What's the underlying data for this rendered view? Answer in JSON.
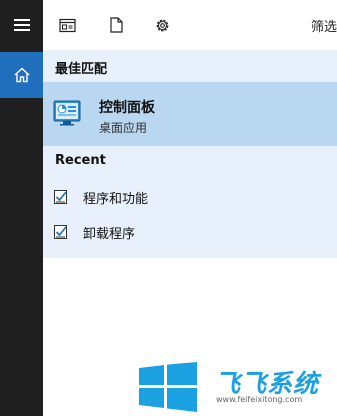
{
  "topbar": {
    "filter_label": "筛选",
    "icons": [
      "document-list-icon",
      "file-icon",
      "gear-icon"
    ]
  },
  "sidebar": {
    "menu_icon": "hamburger-icon",
    "home_icon": "home-icon",
    "accent": "#1f6fbd"
  },
  "results": {
    "best_match_header": "最佳匹配",
    "best_match": {
      "title": "控制面板",
      "subtitle": "桌面应用",
      "icon": "control-panel-icon"
    },
    "recent_header": "Recent",
    "recent_items": [
      {
        "label": "程序和功能",
        "icon": "checklist-icon"
      },
      {
        "label": "卸载程序",
        "icon": "checklist-icon"
      }
    ]
  },
  "watermark": {
    "brand": "飞飞系统",
    "website": "www.feifeixitong.com",
    "brand_color": "#1ba1e2"
  }
}
